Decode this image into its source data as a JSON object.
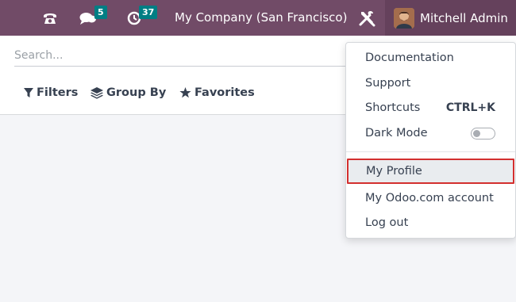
{
  "navbar": {
    "messages_badge": "5",
    "activities_badge": "37",
    "company": "My Company (San Francisco)",
    "user_name": "Mitchell Admin"
  },
  "search": {
    "placeholder": "Search..."
  },
  "filters": {
    "filters_label": "Filters",
    "group_by_label": "Group By",
    "favorites_label": "Favorites"
  },
  "user_menu": {
    "documentation": "Documentation",
    "support": "Support",
    "shortcuts": "Shortcuts",
    "shortcuts_key": "CTRL+K",
    "dark_mode": "Dark Mode",
    "dark_mode_on": false,
    "my_profile": "My Profile",
    "odoo_account": "My Odoo.com account",
    "log_out": "Log out"
  },
  "colors": {
    "navbar": "#714b67",
    "badge": "#017e84",
    "highlight_border": "#d32f2f"
  }
}
